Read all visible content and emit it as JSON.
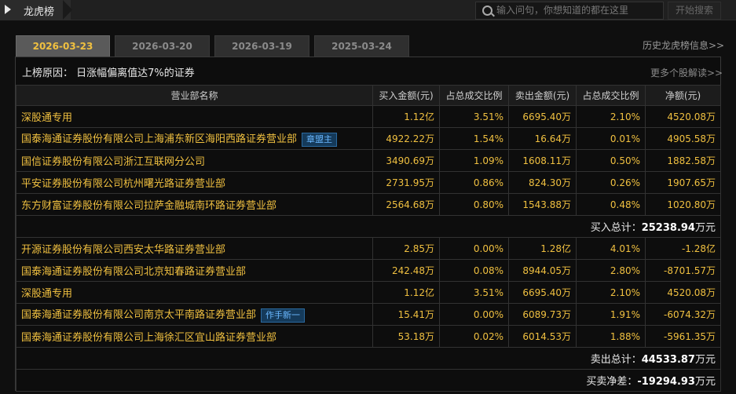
{
  "title": "龙虎榜",
  "search": {
    "placeholder": "输入问句，你想知道的都在这里",
    "button": "开始搜索"
  },
  "date_tabs": [
    {
      "label": "2026-03-23",
      "active": true
    },
    {
      "label": "2026-03-20",
      "active": false
    },
    {
      "label": "2026-03-19",
      "active": false
    },
    {
      "label": "2025-03-24",
      "active": false
    }
  ],
  "history_link": "历史龙虎榜信息>>",
  "more_link": "更多个股解读>>",
  "reason": "上榜原因：  日涨幅偏离值达7%的证券",
  "headers": [
    "营业部名称",
    "买入金额(元)",
    "占总成交比例",
    "卖出金额(元)",
    "占总成交比例",
    "净额(元)"
  ],
  "buy_rows": [
    {
      "name": "深股通专用",
      "tag": "",
      "buy": "1.12亿",
      "buy_pct": "3.51%",
      "sell": "6695.40万",
      "sell_pct": "2.10%",
      "net": "4520.08万"
    },
    {
      "name": "国泰海通证券股份有限公司上海浦东新区海阳西路证券营业部",
      "tag": "章盟主",
      "buy": "4922.22万",
      "buy_pct": "1.54%",
      "sell": "16.64万",
      "sell_pct": "0.01%",
      "net": "4905.58万"
    },
    {
      "name": "国信证券股份有限公司浙江互联网分公司",
      "tag": "",
      "buy": "3490.69万",
      "buy_pct": "1.09%",
      "sell": "1608.11万",
      "sell_pct": "0.50%",
      "net": "1882.58万"
    },
    {
      "name": "平安证券股份有限公司杭州曙光路证券营业部",
      "tag": "",
      "buy": "2731.95万",
      "buy_pct": "0.86%",
      "sell": "824.30万",
      "sell_pct": "0.26%",
      "net": "1907.65万"
    },
    {
      "name": "东方财富证券股份有限公司拉萨金融城南环路证券营业部",
      "tag": "",
      "buy": "2564.68万",
      "buy_pct": "0.80%",
      "sell": "1543.88万",
      "sell_pct": "0.48%",
      "net": "1020.80万"
    }
  ],
  "buy_total": {
    "label": "买入总计：",
    "value": "25238.94",
    "unit": "万元"
  },
  "sell_rows": [
    {
      "name": "开源证券股份有限公司西安太华路证券营业部",
      "tag": "",
      "buy": "2.85万",
      "buy_pct": "0.00%",
      "sell": "1.28亿",
      "sell_pct": "4.01%",
      "net": "-1.28亿"
    },
    {
      "name": "国泰海通证券股份有限公司北京知春路证券营业部",
      "tag": "",
      "buy": "242.48万",
      "buy_pct": "0.08%",
      "sell": "8944.05万",
      "sell_pct": "2.80%",
      "net": "-8701.57万"
    },
    {
      "name": "深股通专用",
      "tag": "",
      "buy": "1.12亿",
      "buy_pct": "3.51%",
      "sell": "6695.40万",
      "sell_pct": "2.10%",
      "net": "4520.08万"
    },
    {
      "name": "国泰海通证券股份有限公司南京太平南路证券营业部",
      "tag": "作手新一",
      "buy": "15.41万",
      "buy_pct": "0.00%",
      "sell": "6089.73万",
      "sell_pct": "1.91%",
      "net": "-6074.32万"
    },
    {
      "name": "国泰海通证券股份有限公司上海徐汇区宜山路证券营业部",
      "tag": "",
      "buy": "53.18万",
      "buy_pct": "0.02%",
      "sell": "6014.53万",
      "sell_pct": "1.88%",
      "net": "-5961.35万"
    }
  ],
  "sell_total": {
    "label": "卖出总计：",
    "value": "44533.87",
    "unit": "万元"
  },
  "net_total": {
    "label": "买卖净差：",
    "value": "-19294.93",
    "unit": "万元"
  }
}
